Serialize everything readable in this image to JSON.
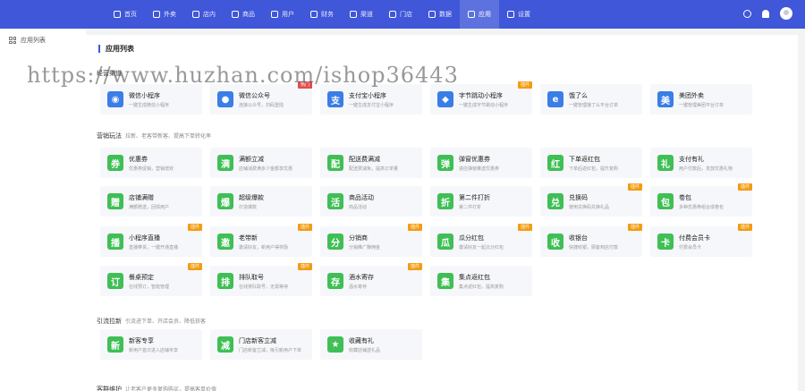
{
  "nav": {
    "items": [
      {
        "label": "首页",
        "icon": "home-icon"
      },
      {
        "label": "外卖",
        "icon": "takeout-icon"
      },
      {
        "label": "店内",
        "icon": "store-icon"
      },
      {
        "label": "商品",
        "icon": "goods-icon"
      },
      {
        "label": "用户",
        "icon": "user-icon"
      },
      {
        "label": "财务",
        "icon": "finance-icon"
      },
      {
        "label": "渠道",
        "icon": "channel-icon"
      },
      {
        "label": "门店",
        "icon": "shop-icon"
      },
      {
        "label": "数据",
        "icon": "data-icon"
      },
      {
        "label": "应用",
        "icon": "app-icon",
        "active": true
      },
      {
        "label": "设置",
        "icon": "settings-icon"
      }
    ]
  },
  "sidebar": {
    "items": [
      {
        "label": "应用列表",
        "icon": "grid-icon"
      }
    ]
  },
  "page": {
    "title": "应用列表"
  },
  "watermark": "https://www.huzhan.com/ishop36443",
  "sections": [
    {
      "title": "经营渠道",
      "subtitle": ""
    },
    {
      "title": "营销玩法",
      "subtitle": "拉新、老客带新客、提高下单转化率"
    },
    {
      "title": "引流拉新",
      "subtitle": "引流进下单、开店会员、降低获客"
    },
    {
      "title": "客群维护",
      "subtitle": "让老客户更多复购购买，提高客单价值"
    }
  ],
  "cards": [
    {
      "name": "微信小程序",
      "desc": "一键生成微信小程序",
      "color": "blue",
      "glyph": "◉"
    },
    {
      "name": "微信公众号",
      "desc": "连接公众号，扫码登陆",
      "color": "blue",
      "glyph": "●",
      "badge": "热门"
    },
    {
      "name": "支付宝小程序",
      "desc": "一键生成支付宝小程序",
      "color": "blue",
      "glyph": "支"
    },
    {
      "name": "字节跳动小程序",
      "desc": "一键生成字节跳动小程序",
      "color": "blue",
      "glyph": "◆",
      "badge": "插件"
    },
    {
      "name": "饿了么",
      "desc": "一键管理饿了么平台订单",
      "color": "blue",
      "glyph": "e"
    },
    {
      "name": "美团外卖",
      "desc": "一键管理美团平台订单",
      "color": "blue",
      "glyph": "美"
    },
    {
      "name": "优惠券",
      "desc": "优惠券促销，营销增效",
      "color": "green",
      "glyph": "券"
    },
    {
      "name": "满额立减",
      "desc": "店铺消费满多少金额享优惠",
      "color": "green",
      "glyph": "满"
    },
    {
      "name": "配送费满减",
      "desc": "配送费减免，提高订单量",
      "color": "green",
      "glyph": "配"
    },
    {
      "name": "弹窗优惠券",
      "desc": "进店弹窗推送优惠券",
      "color": "green",
      "glyph": "弹"
    },
    {
      "name": "下单返红包",
      "desc": "下单后返红包，提升复购",
      "color": "green",
      "glyph": "红"
    },
    {
      "name": "支付有礼",
      "desc": "用户付款后，发放优惠礼物",
      "color": "green",
      "glyph": "礼"
    },
    {
      "name": "店铺满赠",
      "desc": "满额赠送，回馈用户",
      "color": "green",
      "glyph": "赠"
    },
    {
      "name": "超级爆款",
      "desc": "打造爆款",
      "color": "green",
      "glyph": "爆"
    },
    {
      "name": "商品活动",
      "desc": "商品活动",
      "color": "green",
      "glyph": "活"
    },
    {
      "name": "第二件打折",
      "desc": "第二件打折",
      "color": "green",
      "glyph": "折"
    },
    {
      "name": "兑换码",
      "desc": "使用兑换码兑换礼品",
      "color": "green",
      "glyph": "兑",
      "badge": "插件"
    },
    {
      "name": "卷包",
      "desc": "多种优惠券组合成卷包",
      "color": "green",
      "glyph": "包",
      "badge": "插件"
    },
    {
      "name": "小程序直播",
      "desc": "直播带货，一键开通直播",
      "color": "green",
      "glyph": "播",
      "badge": "插件"
    },
    {
      "name": "老带新",
      "desc": "邀请好友，新用户得奖励",
      "color": "green",
      "glyph": "邀",
      "badge": "插件"
    },
    {
      "name": "分销商",
      "desc": "分销推广赚佣金",
      "color": "green",
      "glyph": "分",
      "badge": "插件"
    },
    {
      "name": "瓜分红包",
      "desc": "邀请好友一起瓜分红包",
      "color": "green",
      "glyph": "瓜",
      "badge": "插件"
    },
    {
      "name": "收银台",
      "desc": "快捷收银，顾客到店付款",
      "color": "green",
      "glyph": "收",
      "badge": "插件"
    },
    {
      "name": "付费会员卡",
      "desc": "付费会员卡",
      "color": "green",
      "glyph": "卡",
      "badge": "插件"
    },
    {
      "name": "餐桌预定",
      "desc": "在线预订，智能管理",
      "color": "green",
      "glyph": "订",
      "badge": "插件"
    },
    {
      "name": "排队取号",
      "desc": "在线排队取号，无需等待",
      "color": "green",
      "glyph": "排",
      "badge": "插件"
    },
    {
      "name": "酒水寄存",
      "desc": "酒水寄存",
      "color": "green",
      "glyph": "存",
      "badge": "插件"
    },
    {
      "name": "集点返红包",
      "desc": "集点返红包，提高复购",
      "color": "green",
      "glyph": "集"
    },
    {
      "name": "新客专享",
      "desc": "新用户首次进入店铺专享",
      "color": "green",
      "glyph": "新"
    },
    {
      "name": "门店新客立减",
      "desc": "门店新客立减，吸引新用户下单",
      "color": "green",
      "glyph": "减"
    },
    {
      "name": "收藏有礼",
      "desc": "收藏店铺送礼品",
      "color": "green",
      "glyph": "★"
    }
  ]
}
